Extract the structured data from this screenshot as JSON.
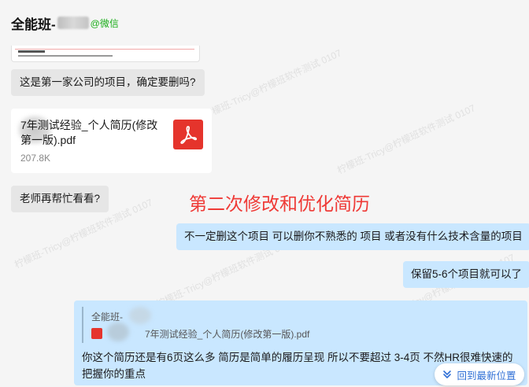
{
  "header": {
    "contact_name": "全能班-",
    "wechat_tag": "@微信"
  },
  "messages": {
    "m1": "这是第一家公司的项目，确定要删吗?",
    "file": {
      "name": "7年测试经验_个人简历(修改第一版).pdf",
      "size": "207.8K",
      "icon": "pdf-icon"
    },
    "m2": "老师再帮忙看看?",
    "annotation": "第二次修改和优化简历",
    "r1": "不一定删这个项目 可以删你不熟悉的 项目 或者没有什么技术含量的项目",
    "r2": "保留5-6个项目就可以了",
    "quote": {
      "sender": "全能班-",
      "file": "7年测试经验_个人简历(修改第一版).pdf",
      "text": "你这个简历还是有6页这么多 简历是简单的履历呈现 所以不要超过 3-4页 不然HR很难快速的把握你的重点"
    }
  },
  "latest_button": "回到最新位置",
  "watermark": "柠檬班-Tricy@柠檬班软件测试 0107",
  "colors": {
    "page_bg": "#f5f5f5",
    "left_bubble": "#e6e6e6",
    "right_bubble": "#c9e7ff",
    "annotation": "#ef3a36",
    "pdf_red": "#e5342c",
    "wechat_green": "#1aad19",
    "link_blue": "#2f6fd6"
  }
}
